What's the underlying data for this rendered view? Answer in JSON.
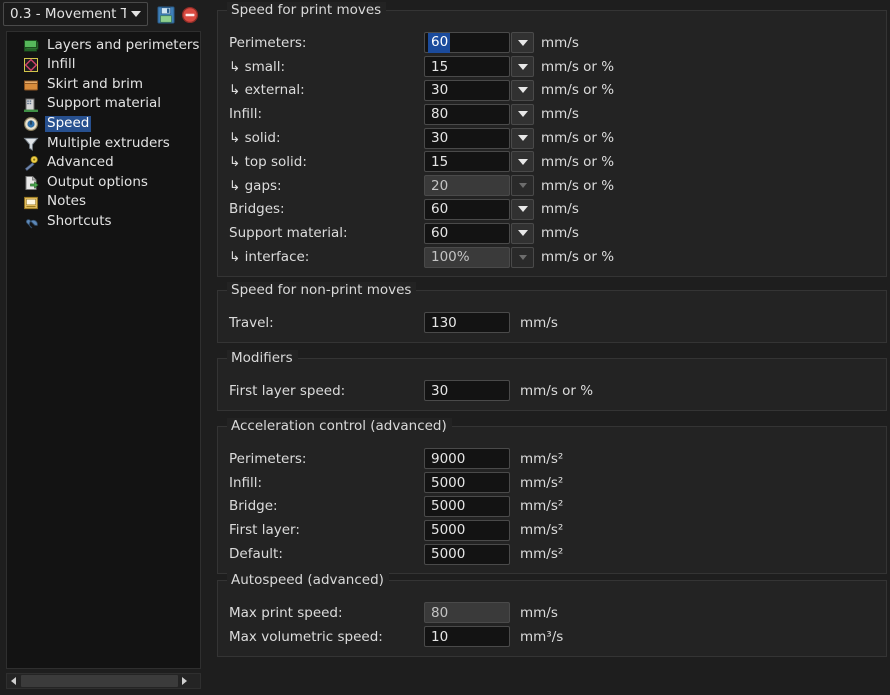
{
  "window": {
    "preset_name": "0.3 - Movement T",
    "save_icon": "floppy-disk-save-icon",
    "delete_icon": "delete-preset-icon",
    "dropdown_icon": "chevron-down-icon"
  },
  "sidebar": {
    "items": [
      {
        "label": "Layers and perimeters",
        "icon": "layers-icon",
        "selected": false
      },
      {
        "label": "Infill",
        "icon": "infill-icon",
        "selected": false
      },
      {
        "label": "Skirt and brim",
        "icon": "skirt-brim-icon",
        "selected": false
      },
      {
        "label": "Support material",
        "icon": "support-material-icon",
        "selected": false
      },
      {
        "label": "Speed",
        "icon": "speed-clock-icon",
        "selected": true
      },
      {
        "label": "Multiple extruders",
        "icon": "funnel-icon",
        "selected": false
      },
      {
        "label": "Advanced",
        "icon": "magic-wand-icon",
        "selected": false
      },
      {
        "label": "Output options",
        "icon": "output-file-icon",
        "selected": false
      },
      {
        "label": "Notes",
        "icon": "notes-icon",
        "selected": false
      },
      {
        "label": "Shortcuts",
        "icon": "wrench-icon",
        "selected": false
      }
    ],
    "scrollbar": {
      "left_arrow": "scroll-left-arrow-icon",
      "right_arrow": "scroll-right-arrow-icon"
    }
  },
  "groups": [
    {
      "title": "Speed for print moves",
      "rows": [
        {
          "label": "Perimeters:",
          "value": "60",
          "unit": "mm/s",
          "combo": true,
          "disabled": false,
          "selected": true
        },
        {
          "label": "↳ small:",
          "value": "15",
          "unit": "mm/s or %",
          "combo": true,
          "disabled": false,
          "selected": false
        },
        {
          "label": "↳ external:",
          "value": "30",
          "unit": "mm/s or %",
          "combo": true,
          "disabled": false,
          "selected": false
        },
        {
          "label": "Infill:",
          "value": "80",
          "unit": "mm/s",
          "combo": true,
          "disabled": false,
          "selected": false
        },
        {
          "label": "↳ solid:",
          "value": "30",
          "unit": "mm/s or %",
          "combo": true,
          "disabled": false,
          "selected": false
        },
        {
          "label": "↳ top solid:",
          "value": "15",
          "unit": "mm/s or %",
          "combo": true,
          "disabled": false,
          "selected": false
        },
        {
          "label": "↳ gaps:",
          "value": "20",
          "unit": "mm/s or %",
          "combo": true,
          "disabled": true,
          "selected": false
        },
        {
          "label": "Bridges:",
          "value": "60",
          "unit": "mm/s",
          "combo": true,
          "disabled": false,
          "selected": false
        },
        {
          "label": "Support material:",
          "value": "60",
          "unit": "mm/s",
          "combo": true,
          "disabled": false,
          "selected": false
        },
        {
          "label": "↳ interface:",
          "value": "100%",
          "unit": "mm/s or %",
          "combo": true,
          "disabled": true,
          "selected": false
        }
      ]
    },
    {
      "title": "Speed for non-print moves",
      "rows": [
        {
          "label": "Travel:",
          "value": "130",
          "unit": "mm/s",
          "combo": false,
          "disabled": false,
          "selected": false
        }
      ]
    },
    {
      "title": "Modifiers",
      "rows": [
        {
          "label": "First layer speed:",
          "value": "30",
          "unit": "mm/s or %",
          "combo": false,
          "disabled": false,
          "selected": false
        }
      ]
    },
    {
      "title": "Acceleration control (advanced)",
      "rows": [
        {
          "label": "Perimeters:",
          "value": "9000",
          "unit": "mm/s²",
          "combo": false,
          "disabled": false,
          "selected": false
        },
        {
          "label": "Infill:",
          "value": "5000",
          "unit": "mm/s²",
          "combo": false,
          "disabled": false,
          "selected": false
        },
        {
          "label": "Bridge:",
          "value": "5000",
          "unit": "mm/s²",
          "combo": false,
          "disabled": false,
          "selected": false
        },
        {
          "label": "First layer:",
          "value": "5000",
          "unit": "mm/s²",
          "combo": false,
          "disabled": false,
          "selected": false
        },
        {
          "label": "Default:",
          "value": "5000",
          "unit": "mm/s²",
          "combo": false,
          "disabled": false,
          "selected": false
        }
      ]
    },
    {
      "title": "Autospeed (advanced)",
      "rows": [
        {
          "label": "Max print speed:",
          "value": "80",
          "unit": "mm/s",
          "combo": false,
          "disabled": true,
          "selected": false
        },
        {
          "label": "Max volumetric speed:",
          "value": "10",
          "unit": "mm³/s",
          "combo": false,
          "disabled": false,
          "selected": false
        }
      ]
    }
  ],
  "colors": {
    "background": "#1e1e1e",
    "group_bg": "#232323",
    "list_bg": "#131313",
    "selection_blue": "#27508f",
    "text": "#dcdcdc"
  }
}
